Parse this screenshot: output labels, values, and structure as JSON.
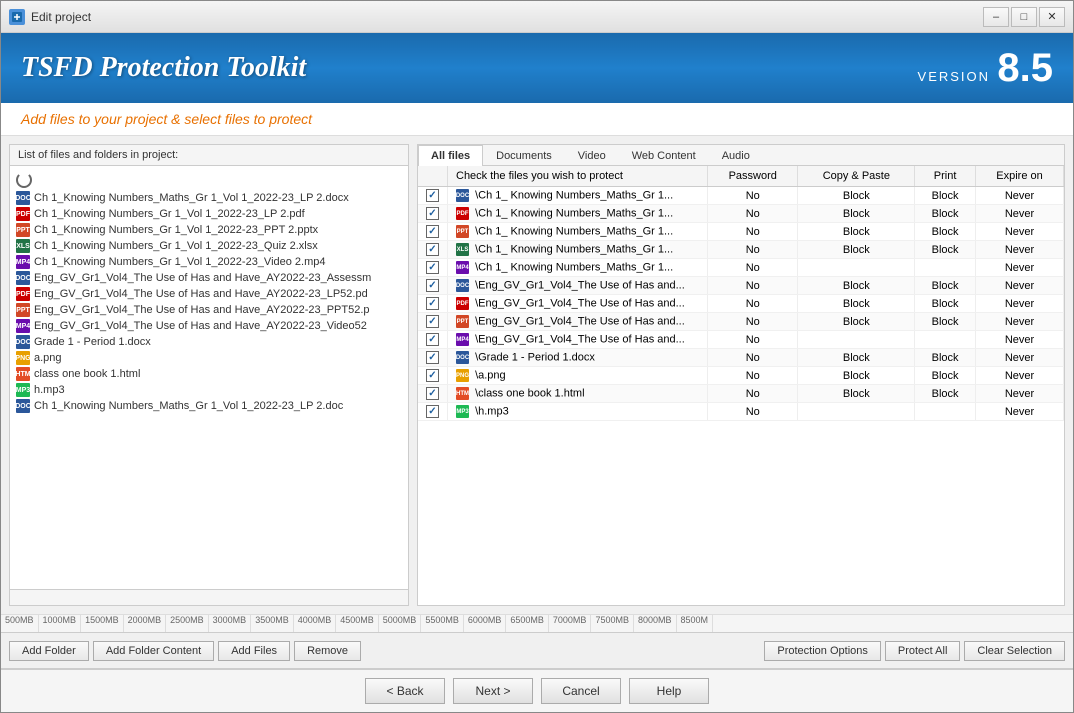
{
  "window": {
    "title": "Edit project",
    "version": "8.5"
  },
  "header": {
    "app_title": "TSFD Protection Toolkit",
    "version_label": "VERSION",
    "version_number": "8.5"
  },
  "subtitle": {
    "text": "Add files to your project & select files to protect"
  },
  "left_panel": {
    "header": "List of files and folders in project:",
    "files": [
      {
        "name": "Ch 1_Knowing Numbers_Maths_Gr 1_Vol 1_2022-23_LP 2.docx",
        "type": "docx"
      },
      {
        "name": "Ch 1_Knowing Numbers_Gr 1_Vol 1_2022-23_LP 2.pdf",
        "type": "pdf"
      },
      {
        "name": "Ch 1_Knowing Numbers_Gr 1_Vol 1_2022-23_PPT 2.pptx",
        "type": "pptx"
      },
      {
        "name": "Ch 1_Knowing Numbers_Gr 1_Vol 1_2022-23_Quiz 2.xlsx",
        "type": "xlsx"
      },
      {
        "name": "Ch 1_Knowing Numbers_Gr 1_Vol 1_2022-23_Video 2.mp4",
        "type": "mp4"
      },
      {
        "name": "Eng_GV_Gr1_Vol4_The Use of Has and Have_AY2022-23_Assessm",
        "type": "docx"
      },
      {
        "name": "Eng_GV_Gr1_Vol4_The Use of Has and Have_AY2022-23_LP52.pd",
        "type": "pdf"
      },
      {
        "name": "Eng_GV_Gr1_Vol4_The Use of Has and Have_AY2022-23_PPT52.p",
        "type": "pptx"
      },
      {
        "name": "Eng_GV_Gr1_Vol4_The Use of Has and Have_AY2022-23_Video52",
        "type": "mp4"
      },
      {
        "name": "Grade 1 - Period 1.docx",
        "type": "docx"
      },
      {
        "name": "a.png",
        "type": "png"
      },
      {
        "name": "class one book 1.html",
        "type": "html"
      },
      {
        "name": "h.mp3",
        "type": "mp3"
      },
      {
        "name": "Ch 1_Knowing Numbers_Maths_Gr 1_Vol 1_2022-23_LP 2.doc",
        "type": "doc"
      }
    ]
  },
  "tabs": {
    "items": [
      "All files",
      "Documents",
      "Video",
      "Web Content",
      "Audio"
    ],
    "active": "All files"
  },
  "table": {
    "headers": [
      "Check the files you wish to protect",
      "Password",
      "Copy & Paste",
      "Print",
      "Expire on"
    ],
    "rows": [
      {
        "checked": true,
        "file": "\\Ch 1_ Knowing Numbers_Maths_Gr 1...",
        "type": "docx",
        "password": "No",
        "copy_paste": "Block",
        "print": "Block",
        "expire": "Never"
      },
      {
        "checked": true,
        "file": "\\Ch 1_ Knowing Numbers_Maths_Gr 1...",
        "type": "pdf",
        "password": "No",
        "copy_paste": "Block",
        "print": "Block",
        "expire": "Never"
      },
      {
        "checked": true,
        "file": "\\Ch 1_ Knowing Numbers_Maths_Gr 1...",
        "type": "pptx",
        "password": "No",
        "copy_paste": "Block",
        "print": "Block",
        "expire": "Never"
      },
      {
        "checked": true,
        "file": "\\Ch 1_ Knowing Numbers_Maths_Gr 1...",
        "type": "xlsx",
        "password": "No",
        "copy_paste": "Block",
        "print": "Block",
        "expire": "Never"
      },
      {
        "checked": true,
        "file": "\\Ch 1_ Knowing Numbers_Maths_Gr 1...",
        "type": "mp4",
        "password": "No",
        "copy_paste": "",
        "print": "",
        "expire": "Never"
      },
      {
        "checked": true,
        "file": "\\Eng_GV_Gr1_Vol4_The Use of Has and...",
        "type": "docx",
        "password": "No",
        "copy_paste": "Block",
        "print": "Block",
        "expire": "Never"
      },
      {
        "checked": true,
        "file": "\\Eng_GV_Gr1_Vol4_The Use of Has and...",
        "type": "pdf",
        "password": "No",
        "copy_paste": "Block",
        "print": "Block",
        "expire": "Never"
      },
      {
        "checked": true,
        "file": "\\Eng_GV_Gr1_Vol4_The Use of Has and...",
        "type": "pptx",
        "password": "No",
        "copy_paste": "Block",
        "print": "Block",
        "expire": "Never"
      },
      {
        "checked": true,
        "file": "\\Eng_GV_Gr1_Vol4_The Use of Has and...",
        "type": "mp4",
        "password": "No",
        "copy_paste": "",
        "print": "",
        "expire": "Never"
      },
      {
        "checked": true,
        "file": "\\Grade 1 - Period 1.docx",
        "type": "docx",
        "password": "No",
        "copy_paste": "Block",
        "print": "Block",
        "expire": "Never"
      },
      {
        "checked": true,
        "file": "\\a.png",
        "type": "png",
        "password": "No",
        "copy_paste": "Block",
        "print": "Block",
        "expire": "Never"
      },
      {
        "checked": true,
        "file": "\\class one book 1.html",
        "type": "html",
        "password": "No",
        "copy_paste": "Block",
        "print": "Block",
        "expire": "Never"
      },
      {
        "checked": true,
        "file": "\\h.mp3",
        "type": "mp3",
        "password": "No",
        "copy_paste": "",
        "print": "",
        "expire": "Never"
      }
    ]
  },
  "storage_scale": [
    "500MB",
    "1000MB",
    "1500MB",
    "2000MB",
    "2500MB",
    "3000MB",
    "3500MB",
    "4000MB",
    "4500MB",
    "5000MB",
    "5500MB",
    "6000MB",
    "6500MB",
    "7000MB",
    "7500MB",
    "8000MB",
    "8500M"
  ],
  "buttons": {
    "add_folder": "Add Folder",
    "add_folder_content": "Add Folder Content",
    "add_files": "Add Files",
    "remove": "Remove",
    "protection_options": "Protection Options",
    "protect_all": "Protect All",
    "clear_selection": "Clear Selection"
  },
  "footer_buttons": {
    "back": "< Back",
    "next": "Next >",
    "cancel": "Cancel",
    "help": "Help"
  }
}
